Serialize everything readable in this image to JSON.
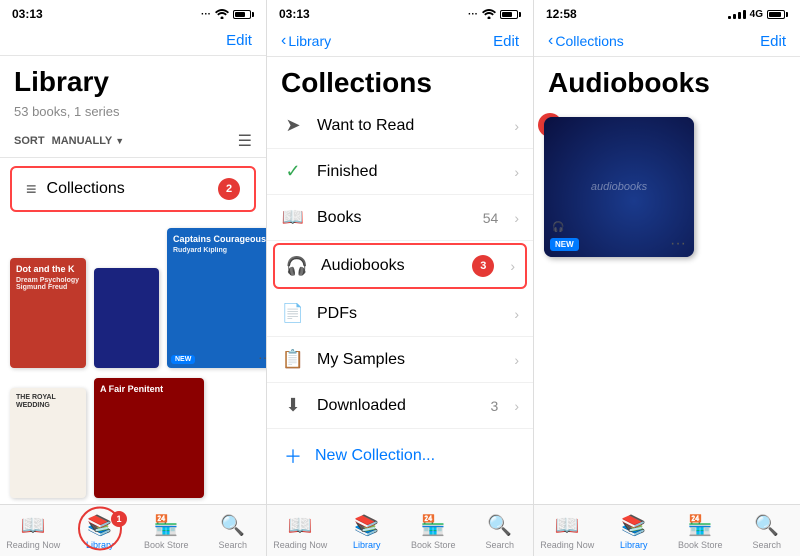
{
  "panel1": {
    "status": {
      "time": "03:13",
      "dots": "···",
      "icons": "📶 🔋"
    },
    "nav": {
      "edit": "Edit"
    },
    "title": "Library",
    "subtitle": "53 books, 1 series",
    "sort": {
      "label": "SORT",
      "value": "MANUALLY"
    },
    "collections_row": {
      "icon": "≡",
      "label": "Collections",
      "badge": "2"
    },
    "books": [
      {
        "title": "Dot and the K",
        "subtitle": "Dream Psychology Sigmund Freud",
        "color": "#c0392b"
      },
      {
        "title": "Captains Courageous",
        "subtitle": "Rudyard Kipling",
        "color": "#1565c0"
      },
      {
        "title": "THE ROYAL WEDDING",
        "color": "#f0e8d0"
      },
      {
        "title": "A Fair Penitent",
        "color": "#8b0000"
      }
    ]
  },
  "panel2": {
    "status": {
      "time": "03:13",
      "dots": "···",
      "icons": "📶 🔋"
    },
    "nav": {
      "back": "Library",
      "edit": "Edit"
    },
    "title": "Collections",
    "items": [
      {
        "icon": "➔",
        "name": "Want to Read",
        "count": "",
        "id": "want-to-read"
      },
      {
        "icon": "✅",
        "name": "Finished",
        "count": "",
        "id": "finished"
      },
      {
        "icon": "📖",
        "name": "Books",
        "count": "54",
        "id": "books"
      },
      {
        "icon": "🎧",
        "name": "Audiobooks",
        "count": "",
        "id": "audiobooks",
        "highlighted": true
      },
      {
        "icon": "📄",
        "name": "PDFs",
        "count": "",
        "id": "pdfs"
      },
      {
        "icon": "📋",
        "name": "My Samples",
        "count": "",
        "id": "my-samples"
      },
      {
        "icon": "⬇",
        "name": "Downloaded",
        "count": "3",
        "id": "downloaded"
      }
    ],
    "new_collection": "New Collection...",
    "badge": "3"
  },
  "panel3": {
    "status": {
      "time": "12:58",
      "signal": "4G",
      "icons": "🔋"
    },
    "nav": {
      "back": "Collections",
      "edit": "Edit"
    },
    "title": "Audiobooks",
    "audiobook": {
      "label": "audiobooks",
      "badge": "4"
    }
  },
  "tab_bars": {
    "panel1_tabs": [
      {
        "icon": "📖",
        "label": "Reading Now",
        "active": false,
        "id": "reading-now"
      },
      {
        "icon": "📚",
        "label": "Library",
        "active": true,
        "id": "library",
        "circled": true,
        "badge": "1"
      },
      {
        "icon": "🏪",
        "label": "Book Store",
        "active": false,
        "id": "book-store"
      },
      {
        "icon": "🔍",
        "label": "Search",
        "active": false,
        "id": "search"
      }
    ],
    "panel2_tabs": [
      {
        "icon": "📖",
        "label": "Reading Now",
        "active": false,
        "id": "reading-now"
      },
      {
        "icon": "📚",
        "label": "Library",
        "active": true,
        "id": "library"
      },
      {
        "icon": "🏪",
        "label": "Book Store",
        "active": false,
        "id": "book-store"
      },
      {
        "icon": "🔍",
        "label": "Search",
        "active": false,
        "id": "search"
      }
    ],
    "panel3_tabs": [
      {
        "icon": "📖",
        "label": "Reading Now",
        "active": false,
        "id": "reading-now"
      },
      {
        "icon": "📚",
        "label": "Library",
        "active": true,
        "id": "library"
      },
      {
        "icon": "🏪",
        "label": "Book Store",
        "active": false,
        "id": "book-store"
      },
      {
        "icon": "🔍",
        "label": "Search",
        "active": false,
        "id": "search"
      }
    ]
  }
}
